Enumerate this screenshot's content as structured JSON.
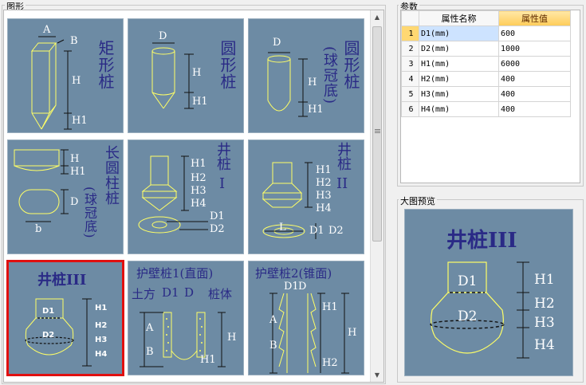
{
  "labels": {
    "shapes": "图形",
    "params": "参数",
    "preview": "大图预览"
  },
  "tiles": [
    {
      "title": "矩形桩",
      "labels": [
        "A",
        "B",
        "H",
        "H1"
      ]
    },
    {
      "title": "圆形桩",
      "labels": [
        "D",
        "H",
        "H1"
      ]
    },
    {
      "title": "圆形桩",
      "subtitle": "(球冠底)",
      "labels": [
        "D",
        "H",
        "H1"
      ]
    },
    {
      "title": "长圆柱桩",
      "subtitle": "(球冠底)",
      "labels": [
        "H",
        "H1",
        "D",
        "b"
      ]
    },
    {
      "title": "井桩",
      "roman": "I",
      "labels": [
        "H1",
        "H2",
        "H3",
        "H4",
        "D1",
        "D2"
      ]
    },
    {
      "title": "井桩",
      "roman": "II",
      "labels": [
        "H1",
        "H2",
        "H3",
        "H4",
        "L",
        "D1",
        "D2"
      ]
    },
    {
      "title": "井桩III",
      "labels": [
        "D1",
        "D2",
        "H1",
        "H2",
        "H3",
        "H4"
      ]
    },
    {
      "title": "护壁桩1(直面)",
      "labels": [
        "土方",
        "D1",
        "D",
        "桩体",
        "A",
        "H",
        "B",
        "H1"
      ]
    },
    {
      "title": "护壁桩2(锥面)",
      "labels": [
        "D1",
        "D",
        "H1",
        "A",
        "H",
        "B",
        "H2"
      ]
    }
  ],
  "table": {
    "headers": [
      "属性名称",
      "属性值"
    ],
    "rows": [
      {
        "num": "1",
        "name": "D1(mm)",
        "value": "600"
      },
      {
        "num": "2",
        "name": "D2(mm)",
        "value": "1000"
      },
      {
        "num": "3",
        "name": "H1(mm)",
        "value": "6000"
      },
      {
        "num": "4",
        "name": "H2(mm)",
        "value": "400"
      },
      {
        "num": "5",
        "name": "H3(mm)",
        "value": "400"
      },
      {
        "num": "6",
        "name": "H4(mm)",
        "value": "400"
      }
    ]
  },
  "preview": {
    "title": "井桩III",
    "labels": [
      "D1",
      "D2",
      "H1",
      "H2",
      "H3",
      "H4"
    ]
  },
  "colors": {
    "tile_bg": "#6d8ba4",
    "title": "#2a2a86",
    "outline": "#ffff66",
    "selected": "#e01010"
  },
  "icons": {
    "scroll_up": "triangle-up-icon",
    "scroll_down": "triangle-down-icon"
  }
}
